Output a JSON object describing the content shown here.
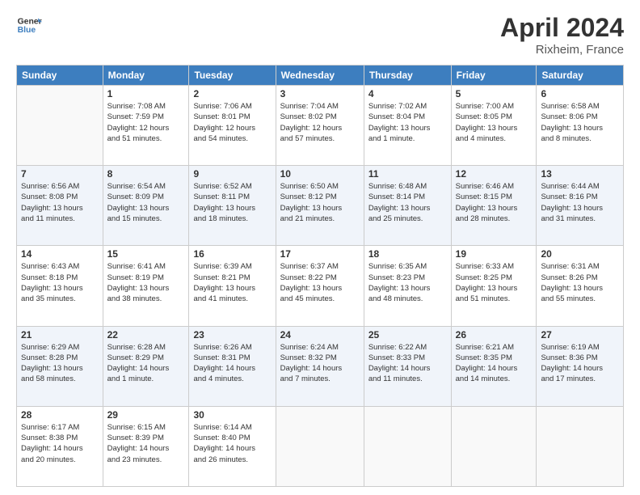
{
  "header": {
    "logo_line1": "General",
    "logo_line2": "Blue",
    "month": "April 2024",
    "location": "Rixheim, France"
  },
  "weekdays": [
    "Sunday",
    "Monday",
    "Tuesday",
    "Wednesday",
    "Thursday",
    "Friday",
    "Saturday"
  ],
  "weeks": [
    [
      {
        "day": "",
        "info": ""
      },
      {
        "day": "1",
        "info": "Sunrise: 7:08 AM\nSunset: 7:59 PM\nDaylight: 12 hours\nand 51 minutes."
      },
      {
        "day": "2",
        "info": "Sunrise: 7:06 AM\nSunset: 8:01 PM\nDaylight: 12 hours\nand 54 minutes."
      },
      {
        "day": "3",
        "info": "Sunrise: 7:04 AM\nSunset: 8:02 PM\nDaylight: 12 hours\nand 57 minutes."
      },
      {
        "day": "4",
        "info": "Sunrise: 7:02 AM\nSunset: 8:04 PM\nDaylight: 13 hours\nand 1 minute."
      },
      {
        "day": "5",
        "info": "Sunrise: 7:00 AM\nSunset: 8:05 PM\nDaylight: 13 hours\nand 4 minutes."
      },
      {
        "day": "6",
        "info": "Sunrise: 6:58 AM\nSunset: 8:06 PM\nDaylight: 13 hours\nand 8 minutes."
      }
    ],
    [
      {
        "day": "7",
        "info": "Sunrise: 6:56 AM\nSunset: 8:08 PM\nDaylight: 13 hours\nand 11 minutes."
      },
      {
        "day": "8",
        "info": "Sunrise: 6:54 AM\nSunset: 8:09 PM\nDaylight: 13 hours\nand 15 minutes."
      },
      {
        "day": "9",
        "info": "Sunrise: 6:52 AM\nSunset: 8:11 PM\nDaylight: 13 hours\nand 18 minutes."
      },
      {
        "day": "10",
        "info": "Sunrise: 6:50 AM\nSunset: 8:12 PM\nDaylight: 13 hours\nand 21 minutes."
      },
      {
        "day": "11",
        "info": "Sunrise: 6:48 AM\nSunset: 8:14 PM\nDaylight: 13 hours\nand 25 minutes."
      },
      {
        "day": "12",
        "info": "Sunrise: 6:46 AM\nSunset: 8:15 PM\nDaylight: 13 hours\nand 28 minutes."
      },
      {
        "day": "13",
        "info": "Sunrise: 6:44 AM\nSunset: 8:16 PM\nDaylight: 13 hours\nand 31 minutes."
      }
    ],
    [
      {
        "day": "14",
        "info": "Sunrise: 6:43 AM\nSunset: 8:18 PM\nDaylight: 13 hours\nand 35 minutes."
      },
      {
        "day": "15",
        "info": "Sunrise: 6:41 AM\nSunset: 8:19 PM\nDaylight: 13 hours\nand 38 minutes."
      },
      {
        "day": "16",
        "info": "Sunrise: 6:39 AM\nSunset: 8:21 PM\nDaylight: 13 hours\nand 41 minutes."
      },
      {
        "day": "17",
        "info": "Sunrise: 6:37 AM\nSunset: 8:22 PM\nDaylight: 13 hours\nand 45 minutes."
      },
      {
        "day": "18",
        "info": "Sunrise: 6:35 AM\nSunset: 8:23 PM\nDaylight: 13 hours\nand 48 minutes."
      },
      {
        "day": "19",
        "info": "Sunrise: 6:33 AM\nSunset: 8:25 PM\nDaylight: 13 hours\nand 51 minutes."
      },
      {
        "day": "20",
        "info": "Sunrise: 6:31 AM\nSunset: 8:26 PM\nDaylight: 13 hours\nand 55 minutes."
      }
    ],
    [
      {
        "day": "21",
        "info": "Sunrise: 6:29 AM\nSunset: 8:28 PM\nDaylight: 13 hours\nand 58 minutes."
      },
      {
        "day": "22",
        "info": "Sunrise: 6:28 AM\nSunset: 8:29 PM\nDaylight: 14 hours\nand 1 minute."
      },
      {
        "day": "23",
        "info": "Sunrise: 6:26 AM\nSunset: 8:31 PM\nDaylight: 14 hours\nand 4 minutes."
      },
      {
        "day": "24",
        "info": "Sunrise: 6:24 AM\nSunset: 8:32 PM\nDaylight: 14 hours\nand 7 minutes."
      },
      {
        "day": "25",
        "info": "Sunrise: 6:22 AM\nSunset: 8:33 PM\nDaylight: 14 hours\nand 11 minutes."
      },
      {
        "day": "26",
        "info": "Sunrise: 6:21 AM\nSunset: 8:35 PM\nDaylight: 14 hours\nand 14 minutes."
      },
      {
        "day": "27",
        "info": "Sunrise: 6:19 AM\nSunset: 8:36 PM\nDaylight: 14 hours\nand 17 minutes."
      }
    ],
    [
      {
        "day": "28",
        "info": "Sunrise: 6:17 AM\nSunset: 8:38 PM\nDaylight: 14 hours\nand 20 minutes."
      },
      {
        "day": "29",
        "info": "Sunrise: 6:15 AM\nSunset: 8:39 PM\nDaylight: 14 hours\nand 23 minutes."
      },
      {
        "day": "30",
        "info": "Sunrise: 6:14 AM\nSunset: 8:40 PM\nDaylight: 14 hours\nand 26 minutes."
      },
      {
        "day": "",
        "info": ""
      },
      {
        "day": "",
        "info": ""
      },
      {
        "day": "",
        "info": ""
      },
      {
        "day": "",
        "info": ""
      }
    ]
  ]
}
